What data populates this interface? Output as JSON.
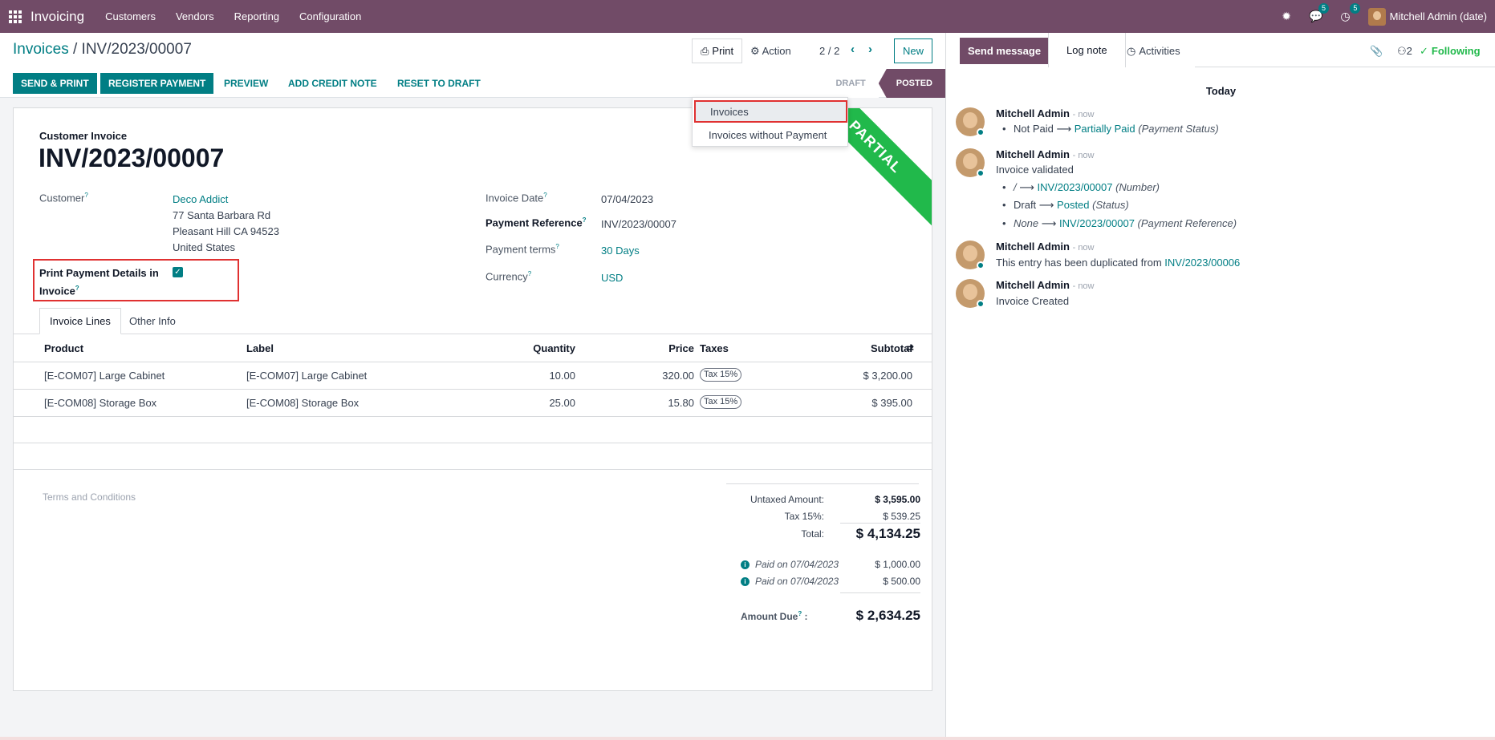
{
  "topbar": {
    "app": "Invoicing",
    "menu": [
      "Customers",
      "Vendors",
      "Reporting",
      "Configuration"
    ],
    "chat_count": "5",
    "activity_count": "5",
    "user": "Mitchell Admin (date)"
  },
  "control": {
    "breadcrumb_root": "Invoices",
    "breadcrumb_current": "INV/2023/00007",
    "print": "Print",
    "action": "Action",
    "pager": "2 / 2",
    "new": "New"
  },
  "print_menu": [
    "Invoices",
    "Invoices without Payment"
  ],
  "actions": [
    "SEND & PRINT",
    "REGISTER PAYMENT",
    "PREVIEW",
    "ADD CREDIT NOTE",
    "RESET TO DRAFT"
  ],
  "status": [
    "DRAFT",
    "POSTED"
  ],
  "invoice": {
    "ribbon": "PARTIAL",
    "type": "Customer Invoice",
    "number": "INV/2023/00007",
    "customer_label": "Customer",
    "customer": "Deco Addict",
    "addr1": "77 Santa Barbara Rd",
    "addr2": "Pleasant Hill CA 94523",
    "addr3": "United States",
    "print_details_label1": "Print Payment Details in",
    "print_details_label2": "Invoice",
    "date_label": "Invoice Date",
    "date": "07/04/2023",
    "payref_label": "Payment Reference",
    "payref": "INV/2023/00007",
    "terms_label": "Payment terms",
    "terms": "30 Days",
    "currency_label": "Currency",
    "currency": "USD"
  },
  "tabs": [
    "Invoice Lines",
    "Other Info"
  ],
  "table": {
    "headers": [
      "Product",
      "Label",
      "Quantity",
      "Price",
      "Taxes",
      "Subtotal"
    ],
    "rows": [
      {
        "product": "[E-COM07] Large Cabinet",
        "label": "[E-COM07] Large Cabinet",
        "qty": "10.00",
        "price": "320.00",
        "tax": "Tax 15%",
        "subtotal": "$ 3,200.00"
      },
      {
        "product": "[E-COM08] Storage Box",
        "label": "[E-COM08] Storage Box",
        "qty": "25.00",
        "price": "15.80",
        "tax": "Tax 15%",
        "subtotal": "$ 395.00"
      }
    ]
  },
  "terms_placeholder": "Terms and Conditions",
  "totals": {
    "untaxed_label": "Untaxed Amount:",
    "untaxed": "$ 3,595.00",
    "tax_label": "Tax 15%:",
    "tax": "$ 539.25",
    "total_label": "Total:",
    "total": "$ 4,134.25",
    "paid1_label": "Paid on 07/04/2023",
    "paid1": "$ 1,000.00",
    "paid2_label": "Paid on 07/04/2023",
    "paid2": "$ 500.00",
    "due_label": "Amount Due",
    "due": "$ 2,634.25"
  },
  "chatter": {
    "send": "Send message",
    "log": "Log note",
    "activities": "Activities",
    "followers": "2",
    "following": "Following",
    "today": "Today",
    "author": "Mitchell Admin",
    "time": "- now",
    "m1": {
      "a": "Not Paid",
      "b": "Partially Paid",
      "c": "(Payment Status)"
    },
    "m2": {
      "title": "Invoice validated",
      "l1a": "/",
      "l1b": "INV/2023/00007",
      "l1c": "(Number)",
      "l2a": "Draft",
      "l2b": "Posted",
      "l2c": "(Status)",
      "l3a": "None",
      "l3b": "INV/2023/00007",
      "l3c": "(Payment Reference)"
    },
    "m3": {
      "text": "This entry has been duplicated from",
      "link": "INV/2023/00006"
    },
    "m4": {
      "text": "Invoice Created"
    }
  }
}
